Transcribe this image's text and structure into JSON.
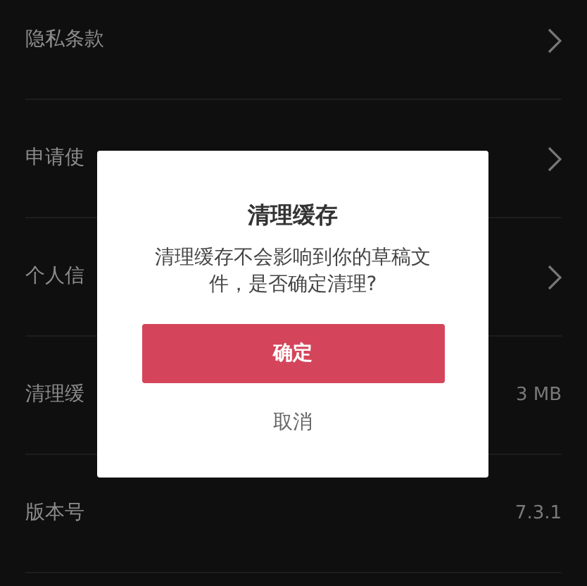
{
  "settings": [
    {
      "kind": "link",
      "label": "隐私条款"
    },
    {
      "kind": "link",
      "label": "申请使"
    },
    {
      "kind": "link",
      "label": "个人信"
    },
    {
      "kind": "value",
      "label": "清理缓",
      "value": "3 MB"
    },
    {
      "kind": "value",
      "label": "版本号",
      "value": "7.3.1"
    }
  ],
  "dialog": {
    "title": "清理缓存",
    "message": "清理缓存不会影响到你的草稿文件，是否确定清理?",
    "confirm": "确定",
    "cancel": "取消"
  }
}
